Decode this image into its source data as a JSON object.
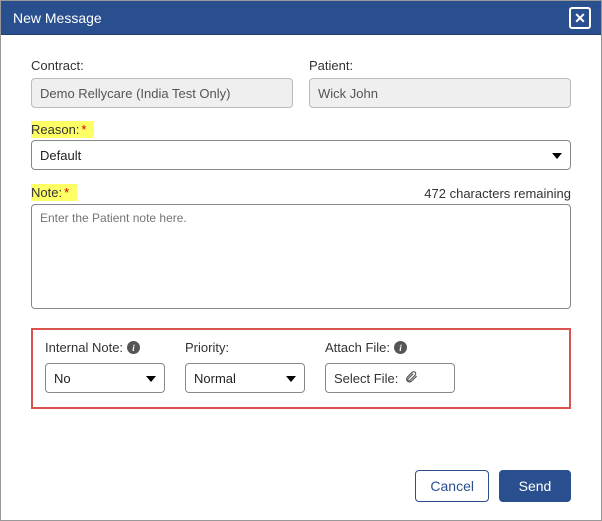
{
  "header": {
    "title": "New Message"
  },
  "fields": {
    "contract": {
      "label": "Contract:",
      "value": "Demo Rellycare (India Test Only)"
    },
    "patient": {
      "label": "Patient:",
      "value": "Wick John"
    },
    "reason": {
      "label": "Reason:",
      "value": "Default"
    },
    "note": {
      "label": "Note:",
      "placeholder": "Enter the Patient note here.",
      "remaining": "472 characters remaining"
    },
    "internal": {
      "label": "Internal Note:",
      "value": "No"
    },
    "priority": {
      "label": "Priority:",
      "value": "Normal"
    },
    "attach": {
      "label": "Attach File:",
      "value": "Select File:"
    }
  },
  "buttons": {
    "cancel": "Cancel",
    "send": "Send"
  }
}
